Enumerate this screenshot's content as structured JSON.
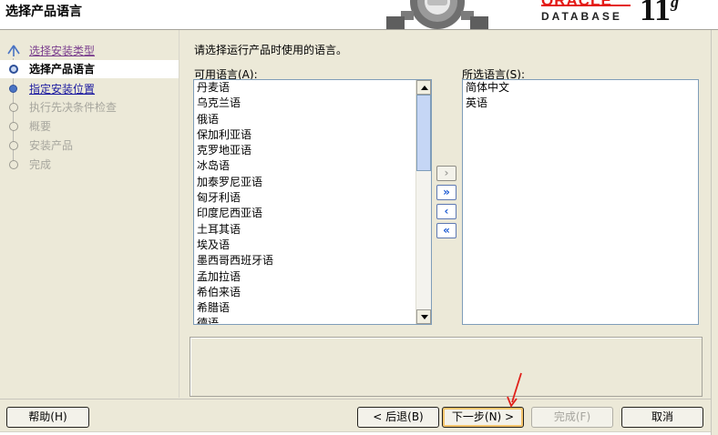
{
  "header": {
    "title": "选择产品语言",
    "logo": {
      "wordmark": "ORACLE",
      "product": "DATABASE",
      "version": "11",
      "version_suffix": "g"
    }
  },
  "nav": {
    "items": [
      {
        "label": "选择安装类型",
        "state": "visited"
      },
      {
        "label": "选择产品语言",
        "state": "current"
      },
      {
        "label": "指定安装位置",
        "state": "link"
      },
      {
        "label": "执行先决条件检查",
        "state": "disabled"
      },
      {
        "label": "概要",
        "state": "disabled"
      },
      {
        "label": "安装产品",
        "state": "disabled"
      },
      {
        "label": "完成",
        "state": "disabled"
      }
    ]
  },
  "main": {
    "instruction": "请选择运行产品时使用的语言。",
    "available_label": "可用语言(A):",
    "selected_label": "所选语言(S):",
    "available_languages": [
      "丹麦语",
      "乌克兰语",
      "俄语",
      "保加利亚语",
      "克罗地亚语",
      "冰岛语",
      "加泰罗尼亚语",
      "匈牙利语",
      "印度尼西亚语",
      "土耳其语",
      "埃及语",
      "墨西哥西班牙语",
      "孟加拉语",
      "希伯来语",
      "希腊语",
      "德语"
    ],
    "selected_languages": [
      "简体中文",
      "英语"
    ],
    "move_buttons": [
      {
        "glyph": "›",
        "name": "add-button",
        "enabled": false
      },
      {
        "glyph": "»",
        "name": "add-all-button",
        "enabled": true
      },
      {
        "glyph": "‹",
        "name": "remove-button",
        "enabled": true
      },
      {
        "glyph": "«",
        "name": "remove-all-button",
        "enabled": true
      }
    ]
  },
  "footer": {
    "help": "帮助(H)",
    "back": "< 后退(B)",
    "next": "下一步(N) >",
    "finish": "完成(F)",
    "cancel": "取消"
  },
  "colors": {
    "oracle_red": "#e41b17",
    "link_blue": "#1c1aa0",
    "visited_purple": "#7b3f8e",
    "window_bg": "#ece9d8",
    "annotation_arrow": "#e0201a"
  }
}
